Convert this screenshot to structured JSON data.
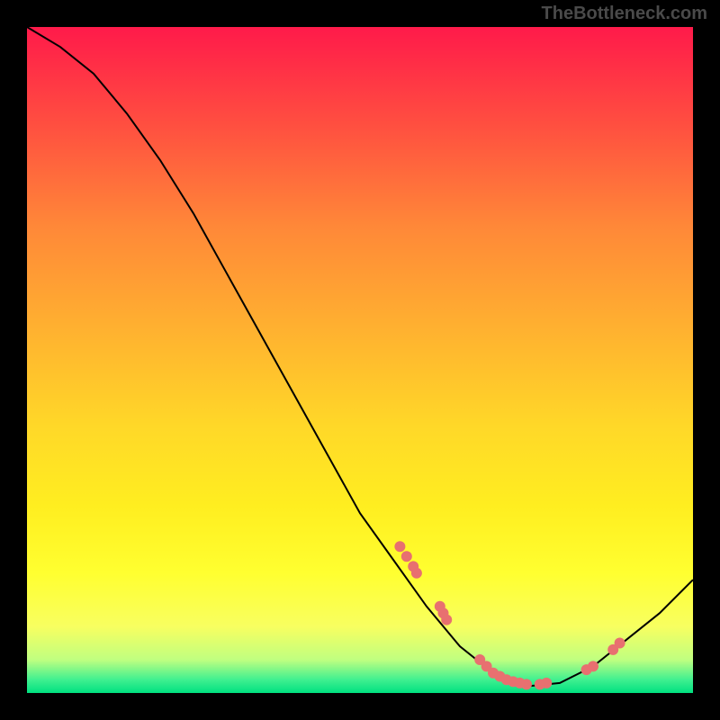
{
  "watermark": "TheBottleneck.com",
  "chart_data": {
    "type": "line",
    "title": "",
    "xlabel": "",
    "ylabel": "",
    "xlim": [
      0,
      100
    ],
    "ylim": [
      0,
      100
    ],
    "curve": [
      {
        "x": 0,
        "y": 100
      },
      {
        "x": 5,
        "y": 97
      },
      {
        "x": 10,
        "y": 93
      },
      {
        "x": 15,
        "y": 87
      },
      {
        "x": 20,
        "y": 80
      },
      {
        "x": 25,
        "y": 72
      },
      {
        "x": 30,
        "y": 63
      },
      {
        "x": 35,
        "y": 54
      },
      {
        "x": 40,
        "y": 45
      },
      {
        "x": 45,
        "y": 36
      },
      {
        "x": 50,
        "y": 27
      },
      {
        "x": 55,
        "y": 20
      },
      {
        "x": 60,
        "y": 13
      },
      {
        "x": 65,
        "y": 7
      },
      {
        "x": 70,
        "y": 3
      },
      {
        "x": 75,
        "y": 1
      },
      {
        "x": 80,
        "y": 1.5
      },
      {
        "x": 85,
        "y": 4
      },
      {
        "x": 90,
        "y": 8
      },
      {
        "x": 95,
        "y": 12
      },
      {
        "x": 100,
        "y": 17
      }
    ],
    "data_points": [
      {
        "x": 56,
        "y": 22
      },
      {
        "x": 57,
        "y": 20.5
      },
      {
        "x": 58,
        "y": 19
      },
      {
        "x": 58.5,
        "y": 18
      },
      {
        "x": 62,
        "y": 13
      },
      {
        "x": 62.5,
        "y": 12
      },
      {
        "x": 63,
        "y": 11
      },
      {
        "x": 68,
        "y": 5
      },
      {
        "x": 69,
        "y": 4
      },
      {
        "x": 70,
        "y": 3
      },
      {
        "x": 71,
        "y": 2.5
      },
      {
        "x": 72,
        "y": 2
      },
      {
        "x": 73,
        "y": 1.7
      },
      {
        "x": 74,
        "y": 1.5
      },
      {
        "x": 75,
        "y": 1.3
      },
      {
        "x": 77,
        "y": 1.3
      },
      {
        "x": 78,
        "y": 1.5
      },
      {
        "x": 84,
        "y": 3.5
      },
      {
        "x": 85,
        "y": 4
      },
      {
        "x": 88,
        "y": 6.5
      },
      {
        "x": 89,
        "y": 7.5
      }
    ],
    "marker_color": "#e87070",
    "line_color": "#000000"
  }
}
